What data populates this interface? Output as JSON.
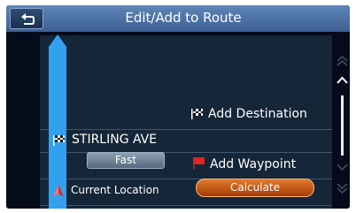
{
  "header": {
    "title": "Edit/Add to Route",
    "back_icon": "return-arrow-icon"
  },
  "route": {
    "destination_name": "STIRLING AVE",
    "route_condition": "Fast",
    "current_location_label": "Current Location"
  },
  "actions": {
    "add_destination": "Add Destination",
    "add_waypoint": "Add Waypoint",
    "calculate": "Calculate"
  },
  "icons": {
    "destination": "checkered-flag-icon",
    "waypoint": "red-flag-icon",
    "current_location": "vehicle-arrow-icon",
    "scroll_top": "double-chevron-up-icon",
    "scroll_up": "chevron-up-icon",
    "scroll_down": "chevron-down-icon",
    "scroll_bottom": "double-chevron-down-icon"
  },
  "colors": {
    "title_bar": "#4d72a6",
    "route_line": "#31a0ef",
    "calculate_button": "#c8591a",
    "background": "#050b1a"
  }
}
